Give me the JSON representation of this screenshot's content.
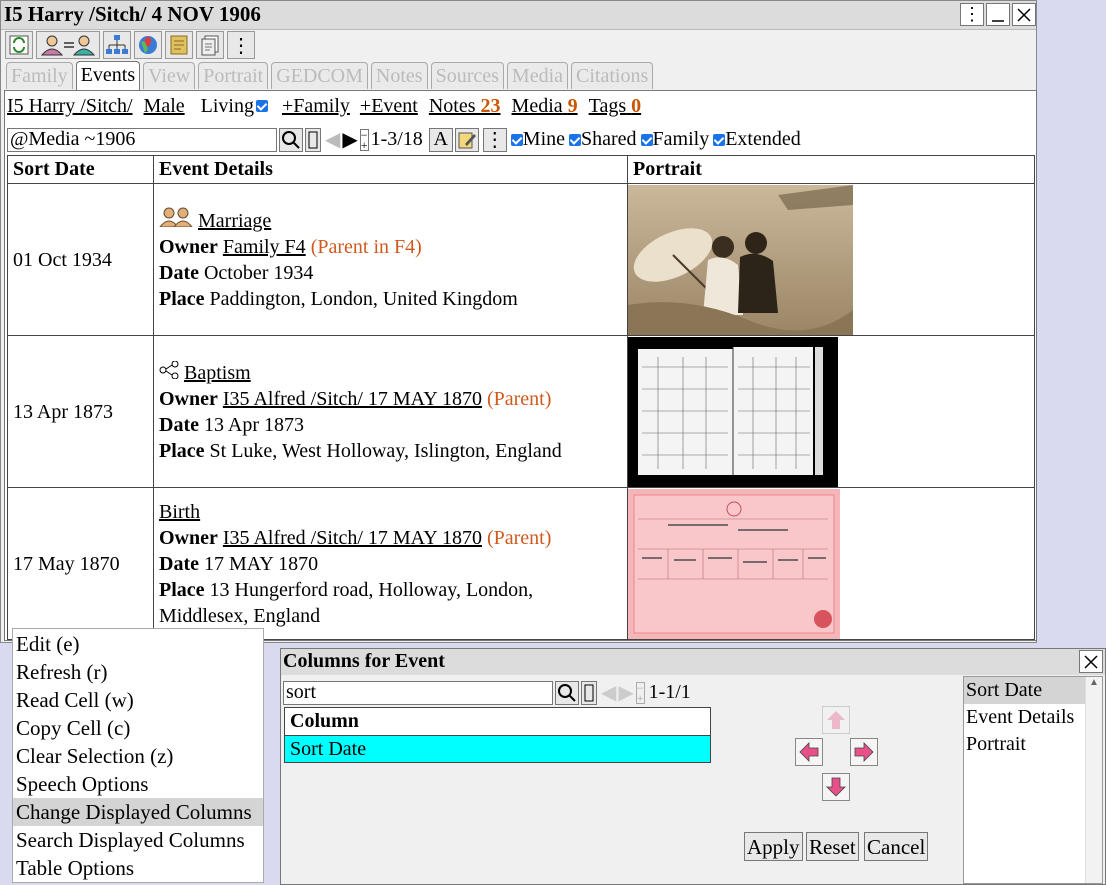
{
  "window": {
    "title": "I5 Harry /Sitch/ 4 NOV 1906",
    "controls": [
      "more-icon",
      "minimize-icon",
      "close-icon"
    ]
  },
  "toolbar": [
    "refresh-icon",
    "swap-person-icon",
    "tree-icon",
    "map-icon",
    "notes-icon",
    "copy-icon",
    "more-icon"
  ],
  "tabs": [
    {
      "label": "Family",
      "active": false
    },
    {
      "label": "Events",
      "active": true
    },
    {
      "label": "View",
      "active": false
    },
    {
      "label": "Portrait",
      "active": false
    },
    {
      "label": "GEDCOM",
      "active": false
    },
    {
      "label": "Notes",
      "active": false
    },
    {
      "label": "Sources",
      "active": false
    },
    {
      "label": "Media",
      "active": false
    },
    {
      "label": "Citations",
      "active": false
    }
  ],
  "person": {
    "name": "I5 Harry /Sitch/",
    "sex": "Male",
    "living_label": "Living",
    "add_family": "+Family",
    "add_event": "+Event",
    "notes_label": "Notes",
    "notes_count": "23",
    "media_label": "Media",
    "media_count": "9",
    "tags_label": "Tags",
    "tags_count": "0"
  },
  "search": {
    "value": "@Media ~1906",
    "range": "1-3/18",
    "font_button": "A",
    "filters": [
      "Mine",
      "Shared",
      "Family",
      "Extended"
    ]
  },
  "table": {
    "headers": [
      "Sort Date",
      "Event Details",
      "Portrait"
    ],
    "labels": {
      "owner": "Owner",
      "date": "Date",
      "place": "Place"
    },
    "rows": [
      {
        "sort_date": "01 Oct 1934",
        "event_icon": "couple-icon",
        "event": "Marriage",
        "owner": "Family F4",
        "owner_note": "(Parent in F4)",
        "date": "October 1934",
        "place": "Paddington, London, United Kingdom",
        "portrait": "beach-couple-photo"
      },
      {
        "sort_date": "13 Apr 1873",
        "event_icon": "share-icon",
        "event": "Baptism",
        "owner": "I35 Alfred /Sitch/ 17 MAY 1870",
        "owner_note": "(Parent)",
        "date": "13 Apr 1873",
        "place": "St Luke, West Holloway, Islington, England",
        "portrait": "register-scan"
      },
      {
        "sort_date": "17 May 1870",
        "event_icon": "",
        "event": "Birth",
        "owner": "I35 Alfred /Sitch/ 17 MAY 1870",
        "owner_note": "(Parent)",
        "date": "17 MAY 1870",
        "place": "13 Hungerford road, Holloway, London, Middlesex, England",
        "portrait": "birth-certificate"
      }
    ]
  },
  "context_menu": [
    {
      "label": "Edit (e)"
    },
    {
      "label": "Refresh (r)"
    },
    {
      "label": "Read Cell (w)"
    },
    {
      "label": "Copy Cell (c)"
    },
    {
      "label": "Clear Selection (z)"
    },
    {
      "label": "Speech Options"
    },
    {
      "label": "Change Displayed Columns",
      "highlighted": true
    },
    {
      "label": "Search Displayed Columns"
    },
    {
      "label": "Table Options"
    }
  ],
  "columns_dialog": {
    "title": "Columns for Event",
    "search_value": "sort",
    "range": "1-1/1",
    "column_header": "Column",
    "rows": [
      "Sort Date"
    ],
    "apply": "Apply",
    "reset": "Reset",
    "cancel": "Cancel",
    "displayed": [
      "Sort Date",
      "Event Details",
      "Portrait"
    ],
    "selected_index": 0
  },
  "colors": {
    "accent_orange": "#d05a1e",
    "selection_cyan": "#00ffff",
    "checkbox_blue": "#1a73e8",
    "arrow_pink": "#e8508a"
  }
}
